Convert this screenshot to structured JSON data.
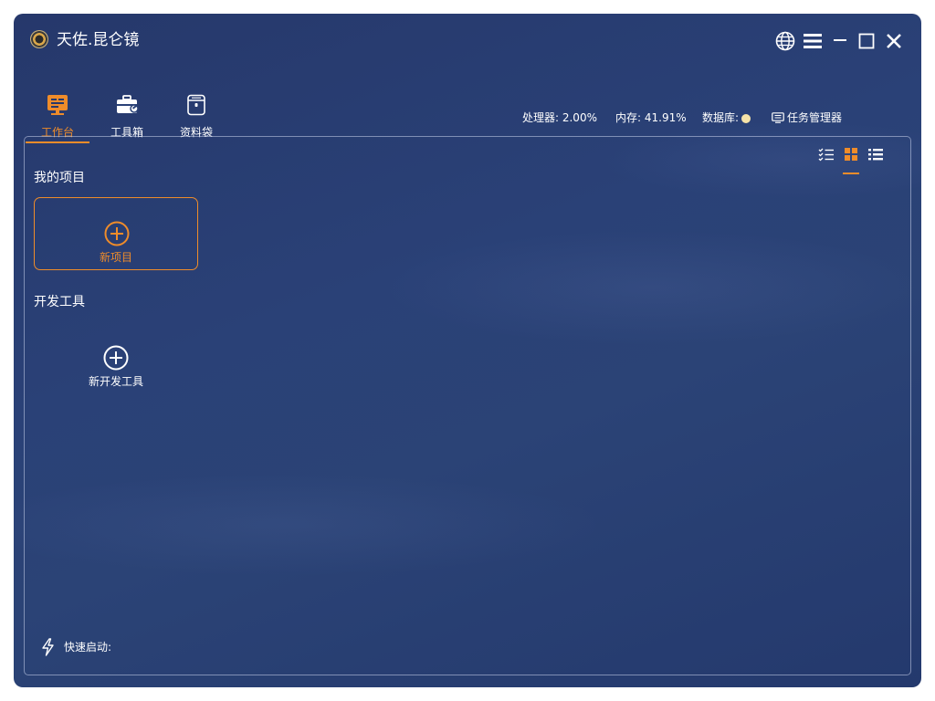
{
  "app": {
    "title": "天佐.昆仑镜"
  },
  "window_controls": {
    "language": "globe-icon",
    "menu": "menu-icon",
    "minimize": "minimize-icon",
    "maximize": "maximize-icon",
    "close": "close-icon"
  },
  "nav": {
    "tabs": [
      {
        "label": "工作台",
        "icon": "workbench-icon",
        "active": true
      },
      {
        "label": "工具箱",
        "icon": "toolbox-icon",
        "active": false
      },
      {
        "label": "资料袋",
        "icon": "folder-bag-icon",
        "active": false
      }
    ]
  },
  "status": {
    "cpu": "处理器: 2.00%",
    "memory": "内存: 41.91%",
    "database_label": "数据库:",
    "database_status_color": "#f6e3a8",
    "task_manager": "任务管理器"
  },
  "view_modes": {
    "active": "grid",
    "options": [
      "checklist",
      "grid",
      "list"
    ]
  },
  "projects": {
    "title": "我的项目",
    "new_label": "新项目"
  },
  "dev_tools": {
    "title": "开发工具",
    "new_label": "新开发工具"
  },
  "quick_launch": {
    "label": "快速启动:"
  },
  "colors": {
    "accent": "#ef8c2a",
    "background": "#2a4177",
    "text": "#ffffff"
  }
}
